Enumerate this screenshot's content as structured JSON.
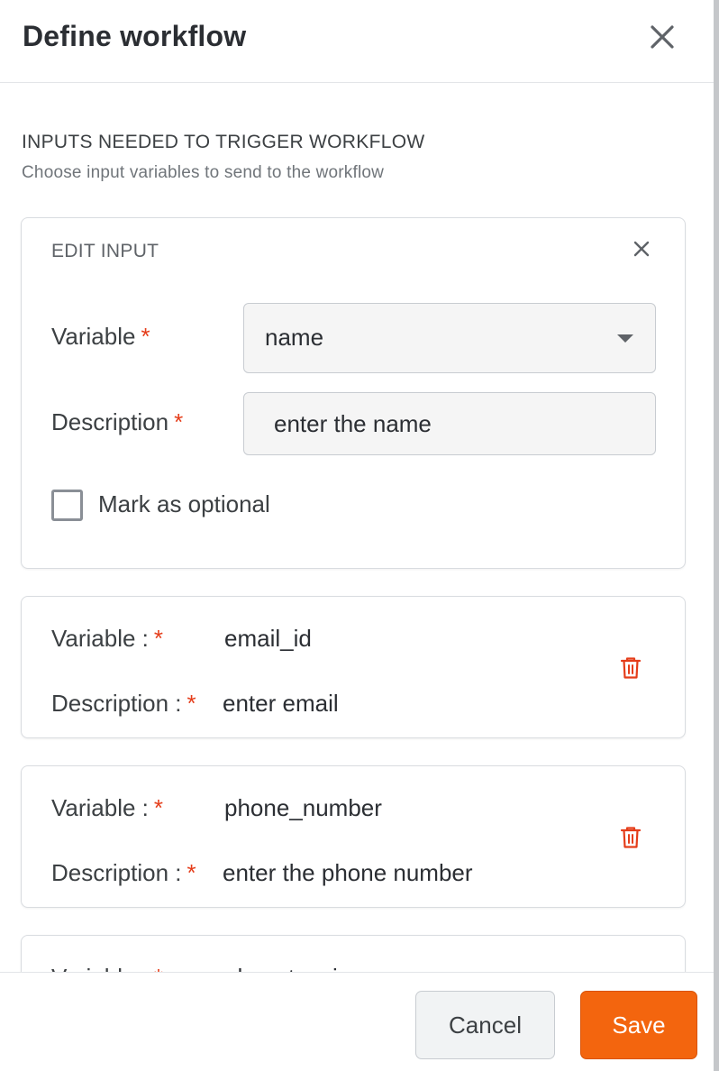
{
  "header": {
    "title": "Define workflow",
    "close_icon": "close-icon"
  },
  "section": {
    "title": "INPUTS NEEDED TO TRIGGER WORKFLOW",
    "subtitle": "Choose input variables to send to the workflow"
  },
  "edit_input": {
    "title": "EDIT INPUT",
    "variable_label": "Variable",
    "variable_value": "name",
    "description_label": "Description",
    "description_value": "enter the name",
    "required_mark": "*",
    "optional_label": "Mark as optional",
    "optional_checked": false
  },
  "inputs": [
    {
      "variable_label": "Variable :",
      "variable_value": "email_id",
      "description_label": "Description :",
      "description_value": "enter email"
    },
    {
      "variable_label": "Variable :",
      "variable_value": "phone_number",
      "description_label": "Description :",
      "description_value": "enter the phone number"
    },
    {
      "variable_label": "Variable :",
      "variable_value": "ph_extension"
    }
  ],
  "footer": {
    "cancel_label": "Cancel",
    "save_label": "Save"
  },
  "colors": {
    "accent": "#f3650e",
    "required": "#e53d1a",
    "delete": "#e53d1a"
  }
}
